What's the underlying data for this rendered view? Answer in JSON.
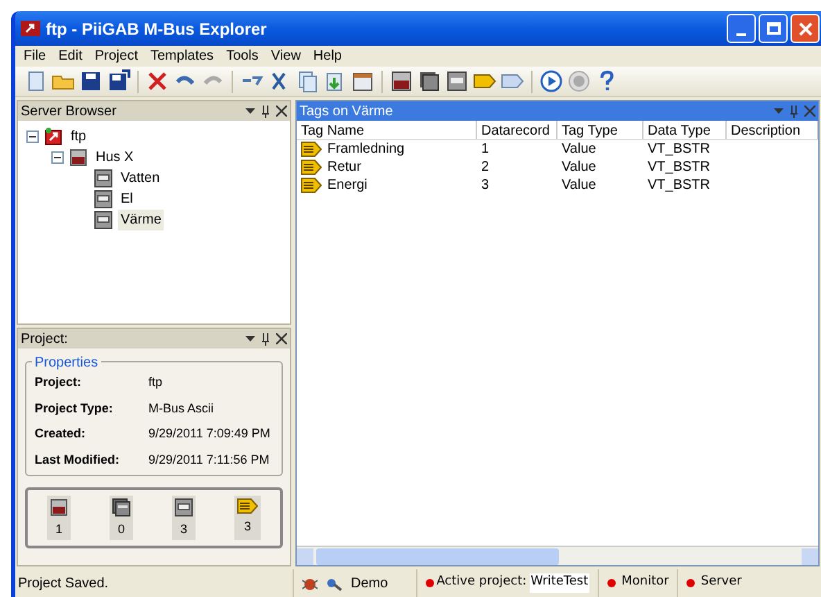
{
  "window": {
    "title": "ftp - PiiGAB M-Bus Explorer"
  },
  "menu": [
    "File",
    "Edit",
    "Project",
    "Templates",
    "Tools",
    "View",
    "Help"
  ],
  "server_browser": {
    "title": "Server Browser",
    "tree": [
      {
        "label": "ftp",
        "kind": "project",
        "expanded": true,
        "selected": false,
        "children": [
          {
            "label": "Hus X",
            "kind": "meter",
            "expanded": true,
            "selected": false,
            "children": [
              {
                "label": "Vatten",
                "kind": "device",
                "selected": false
              },
              {
                "label": "El",
                "kind": "device",
                "selected": false
              },
              {
                "label": "Värme",
                "kind": "device",
                "selected": true
              }
            ]
          }
        ]
      }
    ]
  },
  "project_panel": {
    "title": "Project:",
    "group_title": "Properties",
    "properties": [
      {
        "label": "Project:",
        "value": "ftp"
      },
      {
        "label": "Project Type:",
        "value": "M-Bus Ascii"
      },
      {
        "label": "Created:",
        "value": "9/29/2011 7:09:49 PM"
      },
      {
        "label": "Last Modified:",
        "value": "9/29/2011 7:11:56 PM"
      }
    ],
    "counts": [
      {
        "kind": "meter",
        "count": "1"
      },
      {
        "kind": "stack",
        "count": "0"
      },
      {
        "kind": "device",
        "count": "3"
      },
      {
        "kind": "tag",
        "count": "3"
      }
    ]
  },
  "tags_panel": {
    "title": "Tags on Värme",
    "columns": [
      "Tag Name",
      "Datarecord",
      "Tag Type",
      "Data Type",
      "Description"
    ],
    "rows": [
      [
        "Framledning",
        "1",
        "Value",
        "VT_BSTR",
        ""
      ],
      [
        "Retur",
        "2",
        "Value",
        "VT_BSTR",
        ""
      ],
      [
        "Energi",
        "3",
        "Value",
        "VT_BSTR",
        ""
      ]
    ]
  },
  "status_bar": {
    "message": "Project Saved.",
    "mode": "Demo",
    "active_label": "Active project:",
    "active_value": "WriteTest",
    "indicators": [
      "Monitor",
      "Server"
    ]
  }
}
